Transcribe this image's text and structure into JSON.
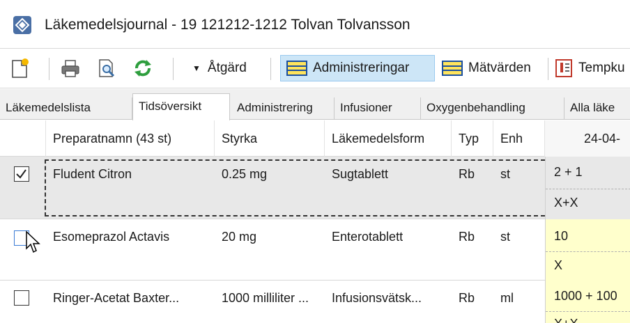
{
  "window": {
    "title": "Läkemedelsjournal - 19 121212-1212 Tolvan Tolvansson"
  },
  "toolbar": {
    "dropdown_label": "Åtgärd",
    "administreringar_label": "Administreringar",
    "matvarden_label": "Mätvärden",
    "temp_label": "Tempku"
  },
  "tabs": [
    {
      "label": "Läkemedelslista"
    },
    {
      "label": "Tidsöversikt"
    },
    {
      "label": "Administrering"
    },
    {
      "label": "Infusioner"
    },
    {
      "label": "Oxygenbehandling"
    },
    {
      "label": "Alla läke"
    }
  ],
  "grid": {
    "columns": {
      "name": "Preparatnamn (43 st)",
      "strength": "Styrka",
      "form": "Läkemedelsform",
      "type": "Typ",
      "unit": "Enh",
      "date": "24-04-"
    },
    "rows": [
      {
        "checked": true,
        "name": "Fludent Citron",
        "strength": "0.25 mg",
        "form": "Sugtablett",
        "type": "Rb",
        "unit": "st",
        "dose": "2 + 1",
        "marks": "X+X"
      },
      {
        "checked": false,
        "name": "Esomeprazol Actavis",
        "strength": "20 mg",
        "form": "Enterotablett",
        "type": "Rb",
        "unit": "st",
        "dose": "10",
        "marks": "X"
      },
      {
        "checked": false,
        "name": "Ringer-Acetat Baxter...",
        "strength": "1000 milliliter ...",
        "form": "Infusionsvätsk...",
        "type": "Rb",
        "unit": "ml",
        "dose": "1000 + 100",
        "marks": "X+X"
      }
    ]
  },
  "colors": {
    "selected_row": "#e8e8e8",
    "dose_cell": "#ffffcc",
    "toolbar_active": "#cde6f7"
  }
}
